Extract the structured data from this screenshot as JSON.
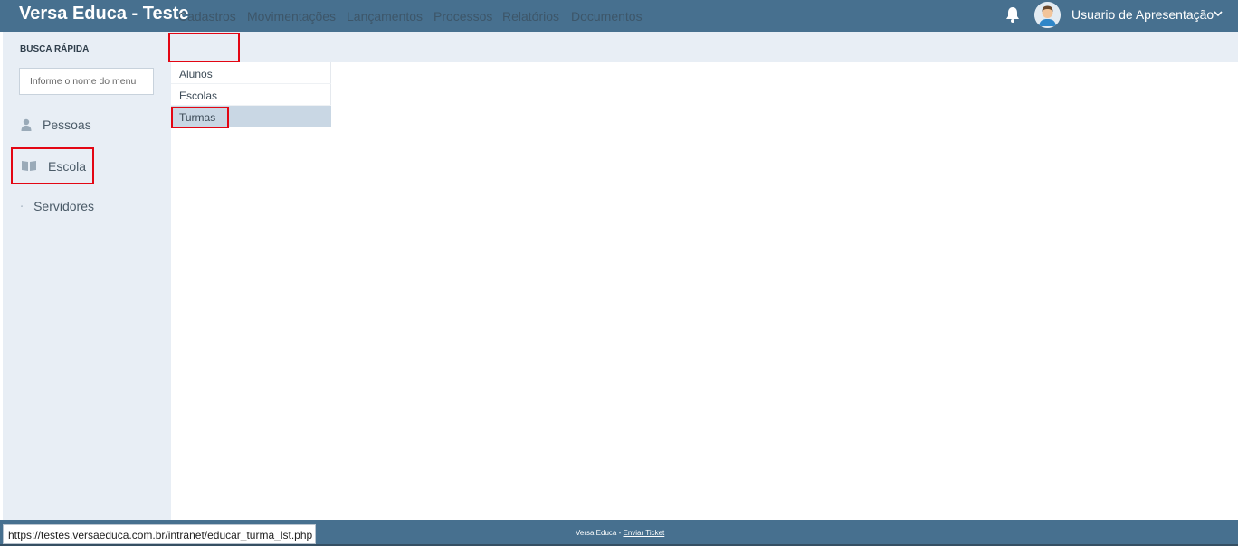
{
  "header": {
    "title": "Versa Educa - Teste",
    "user_name": "Usuario de Apresentação",
    "bell_icon": "bell-icon",
    "chevron_icon": "chevron-down-icon"
  },
  "sidebar": {
    "quick_search_label": "BUSCA RÁPIDA",
    "quick_search_placeholder": "Informe o nome do menu",
    "items": [
      {
        "label": "Pessoas",
        "icon": "person-icon"
      },
      {
        "label": "Escola",
        "icon": "book-icon"
      },
      {
        "label": "Servidores",
        "icon": "users-icon"
      }
    ]
  },
  "menu": {
    "items": [
      "Cadastros",
      "Movimentações",
      "Lançamentos",
      "Processos",
      "Relatórios",
      "Documentos"
    ],
    "submenu": [
      "Alunos",
      "Escolas",
      "Turmas"
    ]
  },
  "footer": {
    "brand": "Versa Educa - ",
    "link": "Enviar Ticket"
  },
  "status_url": "https://testes.versaeduca.com.br/intranet/educar_turma_lst.php",
  "colors": {
    "header_bg": "#47708f",
    "sidebar_bg": "#e8eef5",
    "highlight": "#e30613",
    "active_bg": "#c9d7e4"
  }
}
